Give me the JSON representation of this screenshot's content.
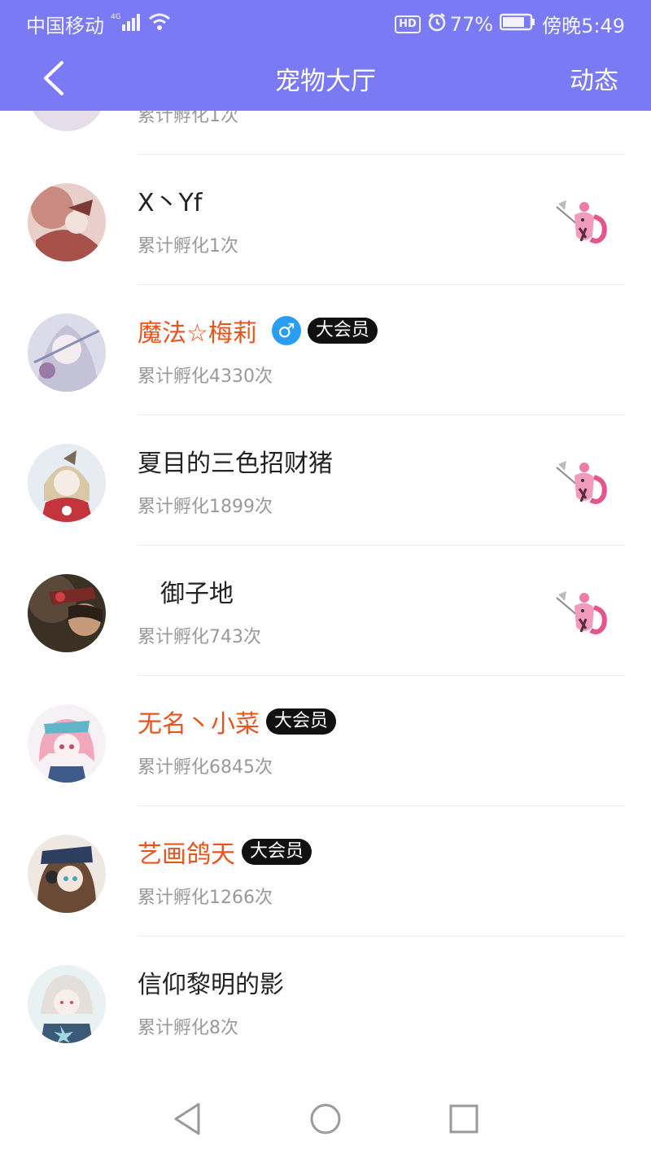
{
  "status_bar": {
    "carrier": "中国移动",
    "network": "4G",
    "hd_label": "HD",
    "battery": "77%",
    "time": "傍晚5:49"
  },
  "header": {
    "title": "宠物大厅",
    "right_action": "动态"
  },
  "colors": {
    "header_bg": "#7a7af5",
    "vip_name": "#e8541e",
    "gender_male": "#2a9df4"
  },
  "list": [
    {
      "name": "",
      "stat": "累计孵化1次",
      "vip": false
    },
    {
      "name": "X丶Yf",
      "stat": "累计孵化1次",
      "vip": false,
      "pet_icon": "pink-pet-icon"
    },
    {
      "name": "魔法☆梅莉",
      "stat": "累计孵化4330次",
      "vip": true,
      "gender": "♂",
      "badge": "大会员"
    },
    {
      "name": "夏目的三色招财猪",
      "stat": "累计孵化1899次",
      "vip": false,
      "pet_icon": "pink-pet-icon"
    },
    {
      "name": "御子地",
      "stat": "累计孵化743次",
      "vip": false,
      "pet_icon": "pink-pet-icon"
    },
    {
      "name": "无名丶小菜",
      "stat": "累计孵化6845次",
      "vip": true,
      "badge": "大会员"
    },
    {
      "name": "艺画鸽天",
      "stat": "累计孵化1266次",
      "vip": true,
      "badge": "大会员"
    },
    {
      "name": "信仰黎明的影",
      "stat": "累计孵化8次",
      "vip": false
    }
  ]
}
